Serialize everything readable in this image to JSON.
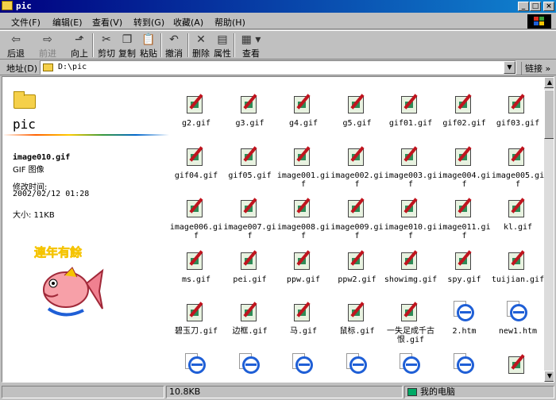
{
  "window": {
    "title": "pic"
  },
  "menu": [
    "文件(F)",
    "编辑(E)",
    "查看(V)",
    "转到(G)",
    "收藏(A)",
    "帮助(H)"
  ],
  "toolbar": {
    "back": "后退",
    "forward": "前进",
    "up": "向上",
    "cut": "剪切",
    "copy": "复制",
    "paste": "粘贴",
    "undo": "撤消",
    "delete": "删除",
    "properties": "属性",
    "views": "查看"
  },
  "address": {
    "label": "地址(D)",
    "value": "D:\\pic",
    "links": "链接"
  },
  "details": {
    "folder_name": "pic",
    "file_name": "image010.gif",
    "file_type": "GIF 图像",
    "modified_label": "修改时间:",
    "modified": "2002/02/12 01:28",
    "size": "大小: 11KB",
    "image_text": "连年有余"
  },
  "files": [
    {
      "name": "g2.gif",
      "type": "gif"
    },
    {
      "name": "g3.gif",
      "type": "gif"
    },
    {
      "name": "g4.gif",
      "type": "gif"
    },
    {
      "name": "g5.gif",
      "type": "gif"
    },
    {
      "name": "gif01.gif",
      "type": "gif"
    },
    {
      "name": "gif02.gif",
      "type": "gif"
    },
    {
      "name": "gif03.gif",
      "type": "gif"
    },
    {
      "name": "gif04.gif",
      "type": "gif"
    },
    {
      "name": "gif05.gif",
      "type": "gif"
    },
    {
      "name": "image001.gif",
      "type": "gif"
    },
    {
      "name": "image002.gif",
      "type": "gif"
    },
    {
      "name": "image003.gif",
      "type": "gif"
    },
    {
      "name": "image004.gif",
      "type": "gif"
    },
    {
      "name": "image005.gif",
      "type": "gif"
    },
    {
      "name": "image006.gif",
      "type": "gif"
    },
    {
      "name": "image007.gif",
      "type": "gif"
    },
    {
      "name": "image008.gif",
      "type": "gif"
    },
    {
      "name": "image009.gif",
      "type": "gif"
    },
    {
      "name": "image010.gif",
      "type": "gif"
    },
    {
      "name": "image011.gif",
      "type": "gif"
    },
    {
      "name": "kl.gif",
      "type": "gif"
    },
    {
      "name": "ms.gif",
      "type": "gif"
    },
    {
      "name": "pei.gif",
      "type": "gif"
    },
    {
      "name": "ppw.gif",
      "type": "gif"
    },
    {
      "name": "ppw2.gif",
      "type": "gif"
    },
    {
      "name": "showimg.gif",
      "type": "gif"
    },
    {
      "name": "spy.gif",
      "type": "gif"
    },
    {
      "name": "tuijian.gif",
      "type": "gif"
    },
    {
      "name": "碧玉刀.gif",
      "type": "gif"
    },
    {
      "name": "边框.gif",
      "type": "gif"
    },
    {
      "name": "马.gif",
      "type": "gif"
    },
    {
      "name": "鼠标.gif",
      "type": "gif"
    },
    {
      "name": "一失足成千古恨.gif",
      "type": "gif"
    },
    {
      "name": "2.htm",
      "type": "htm"
    },
    {
      "name": "new1.htm",
      "type": "htm"
    },
    {
      "name": "",
      "type": "htm"
    },
    {
      "name": "",
      "type": "htm"
    },
    {
      "name": "",
      "type": "htm"
    },
    {
      "name": "",
      "type": "htm"
    },
    {
      "name": "",
      "type": "htm"
    },
    {
      "name": "",
      "type": "htm"
    },
    {
      "name": "",
      "type": "gif"
    }
  ],
  "status": {
    "size": "10.8KB",
    "zone": "我的电脑"
  }
}
